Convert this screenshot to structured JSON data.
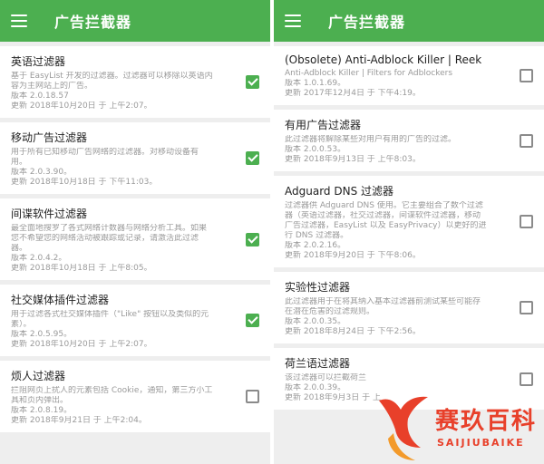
{
  "left": {
    "title": "广告拦截器",
    "items": [
      {
        "title": "英语过滤器",
        "lines": [
          "基于 EasyList 开发的过滤器。过滤器可以移除以英语内",
          "容为主网站上的广告。",
          "版本 2.0.18.57",
          "更新 2018年10月20日 于 上午2:07。"
        ],
        "checked": true
      },
      {
        "title": "移动广告过滤器",
        "lines": [
          "用于所有已知移动广告网络的过滤器。对移动设备有",
          "用。",
          "版本 2.0.3.90。",
          "更新 2018年10月18日 于 下午11:03。"
        ],
        "checked": true
      },
      {
        "title": "间谍软件过滤器",
        "lines": [
          "最全面地搜罗了各式网络计数器与网络分析工具。如果",
          "您不希望您的网络活动被跟踪或记录，请激活此过滤",
          "器。",
          "版本 2.0.4.2。",
          "更新 2018年10月18日 于 上午8:05。"
        ],
        "checked": true
      },
      {
        "title": "社交媒体插件过滤器",
        "lines": [
          "用于过滤各式社交媒体插件（\"Like\" 按钮以及类似的元",
          "素）。",
          "版本 2.0.5.95。",
          "更新 2018年10月20日 于 上午2:07。"
        ],
        "checked": true
      },
      {
        "title": "烦人过滤器",
        "lines": [
          "拦阻网页上扰人的元素包括 Cookie，通知，第三方小工",
          "具和页内弹出。",
          "版本 2.0.8.19。",
          "更新 2018年9月21日 于 上午2:04。"
        ],
        "checked": false
      }
    ]
  },
  "right": {
    "title": "广告拦截器",
    "items": [
      {
        "title": "(Obsolete) Anti-Adblock Killer | Reek",
        "lines": [
          "Anti-Adblock Killer | Filters for Adblockers",
          "版本 1.0.1.69。",
          "更新 2017年12月4日 于 下午4:19。"
        ],
        "checked": false
      },
      {
        "title": "有用广告过滤器",
        "lines": [
          "此过滤器将解除某些对用户有用的广告的过滤。",
          "版本 2.0.0.53。",
          "更新 2018年9月13日 于 上午8:03。"
        ],
        "checked": false
      },
      {
        "title": "Adguard DNS 过滤器",
        "lines": [
          "过滤器供 Adguard DNS 使用。它主要组合了数个过滤",
          "器（英语过滤器，社交过滤器，间谍软件过滤器，移动",
          "广告过滤器，EasyList 以及 EasyPrivacy）以更好的进",
          "行 DNS 过滤器。",
          "版本 2.0.2.16。",
          "更新 2018年9月20日 于 下午8:06。"
        ],
        "checked": false
      },
      {
        "title": "实验性过滤器",
        "lines": [
          "此过滤器用于在将其纳入基本过滤器前测试某些可能存",
          "在潜在危害的过滤规则。",
          "版本 2.0.0.35。",
          "更新 2018年8月24日 于 下午2:56。"
        ],
        "checked": false
      },
      {
        "title": "荷兰语过滤器",
        "lines": [
          "该过滤器可以拦截荷兰",
          "版本 2.0.0.39。",
          "更新 2018年9月3日 于 上"
        ],
        "checked": false
      }
    ]
  },
  "watermark": {
    "cn": "赛玖百科",
    "en": "SAIJIUBAIKE",
    "color": "#e8402a"
  },
  "colors": {
    "appbar": "#4caf50",
    "checkbox_on": "#4caf50",
    "background": "#eeeeee"
  }
}
